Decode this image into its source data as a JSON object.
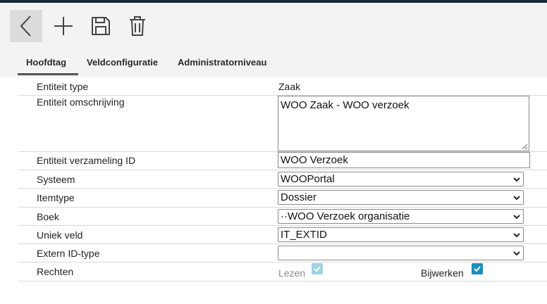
{
  "toolbar": {
    "back_icon": "chevron-left-icon",
    "add_icon": "plus-icon",
    "save_icon": "floppy-disk-icon",
    "delete_icon": "trash-icon"
  },
  "tabs": [
    {
      "label": "Hoofdtag",
      "active": true
    },
    {
      "label": "Veldconfiguratie",
      "active": false
    },
    {
      "label": "Administratorniveau",
      "active": false
    }
  ],
  "form": {
    "entity_type": {
      "label": "Entiteit type",
      "value": "Zaak"
    },
    "entity_description": {
      "label": "Entiteit omschrijving",
      "value": "WOO Zaak - WOO verzoek"
    },
    "collection_id": {
      "label": "Entiteit verzameling ID",
      "value": "WOO Verzoek"
    },
    "system": {
      "label": "Systeem",
      "value": "WOOPortal"
    },
    "item_type": {
      "label": "Itemtype",
      "value": "Dossier"
    },
    "book": {
      "label": "Boek",
      "value": "··WOO Verzoek organisatie"
    },
    "unique_field": {
      "label": "Uniek veld",
      "value": "IT_EXTID"
    },
    "extern_id_type": {
      "label": "Extern ID-type",
      "value": ""
    },
    "rights": {
      "label": "Rechten",
      "read_label": "Lezen",
      "read_checked": true,
      "read_disabled": true,
      "write_label": "Bijwerken",
      "write_checked": true
    }
  },
  "colors": {
    "checkbox_active": "#1a8fb7",
    "checkbox_disabled": "#9fd3e3",
    "tab_underline": "#555555",
    "toolbar_bg": "#f3f3f3"
  }
}
